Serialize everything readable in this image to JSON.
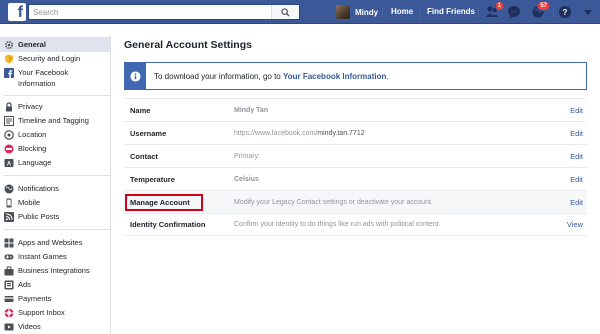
{
  "topbar": {
    "logo": "f",
    "search_placeholder": "Search",
    "user_name": "Mindy",
    "home": "Home",
    "find_friends": "Find Friends",
    "friend_requests_count": "1",
    "notifications_count": "57"
  },
  "sidebar": {
    "groups": [
      [
        {
          "label": "General",
          "icon": "gear-icon",
          "active": true
        },
        {
          "label": "Security and Login",
          "icon": "shield-icon"
        },
        {
          "label": "Your Facebook Information",
          "icon": "facebook-icon"
        }
      ],
      [
        {
          "label": "Privacy",
          "icon": "lock-icon"
        },
        {
          "label": "Timeline and Tagging",
          "icon": "timeline-icon"
        },
        {
          "label": "Location",
          "icon": "location-icon"
        },
        {
          "label": "Blocking",
          "icon": "blocking-icon"
        },
        {
          "label": "Language",
          "icon": "language-icon"
        }
      ],
      [
        {
          "label": "Notifications",
          "icon": "globe-icon"
        },
        {
          "label": "Mobile",
          "icon": "mobile-icon"
        },
        {
          "label": "Public Posts",
          "icon": "rss-icon"
        }
      ],
      [
        {
          "label": "Apps and Websites",
          "icon": "apps-icon"
        },
        {
          "label": "Instant Games",
          "icon": "games-icon"
        },
        {
          "label": "Business Integrations",
          "icon": "business-icon"
        },
        {
          "label": "Ads",
          "icon": "ads-icon"
        },
        {
          "label": "Payments",
          "icon": "payments-icon"
        },
        {
          "label": "Support Inbox",
          "icon": "support-icon"
        },
        {
          "label": "Videos",
          "icon": "videos-icon"
        }
      ]
    ]
  },
  "main": {
    "title": "General Account Settings",
    "info_text": "To download your information, go to ",
    "info_link": "Your Facebook Information",
    "info_end": ".",
    "rows": [
      {
        "label": "Name",
        "value": "Mindy Tan",
        "value_style": "bold",
        "action": "Edit"
      },
      {
        "label": "Username",
        "value_prefix": "https://www.facebook.com/",
        "value": "mindy.tan.7712",
        "value_style": "url",
        "action": "Edit"
      },
      {
        "label": "Contact",
        "value": "Primary:",
        "value_style": "plain",
        "action": "Edit"
      },
      {
        "label": "Temperature",
        "value": "Celsius",
        "value_style": "bold",
        "action": "Edit"
      },
      {
        "label": "Manage Account",
        "value": "Modify your Legacy Contact settings or deactivate your account.",
        "value_style": "plain",
        "action": "Edit",
        "highlighted": true
      },
      {
        "label": "Identity Confirmation",
        "value": "Confirm your identity to do things like run ads with political content.",
        "value_style": "plain",
        "action": "View"
      }
    ]
  },
  "colors": {
    "brand": "#3b5998",
    "link": "#365899",
    "highlight": "#d0021b",
    "badge": "#fa3e3e"
  }
}
